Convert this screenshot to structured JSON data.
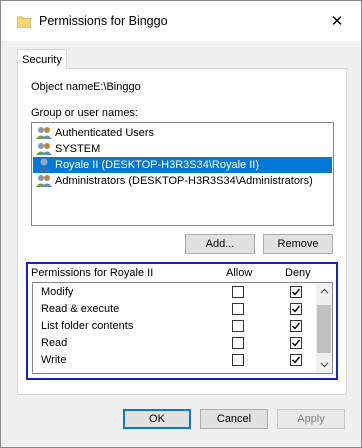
{
  "window": {
    "title": "Permissions for Binggo",
    "close_glyph": "✕"
  },
  "tabs": [
    {
      "label": "Security",
      "active": true
    }
  ],
  "object": {
    "label": "Object name:",
    "value": "E:\\Binggo"
  },
  "group": {
    "label": "Group or user names:",
    "items": [
      {
        "label": "Authenticated Users",
        "icon": "group-users-icon",
        "selected": false
      },
      {
        "label": "SYSTEM",
        "icon": "group-users-icon",
        "selected": false
      },
      {
        "label": "Royale II (DESKTOP-H3R3S34\\Royale II)",
        "icon": "user-icon",
        "selected": true
      },
      {
        "label": "Administrators (DESKTOP-H3R3S34\\Administrators)",
        "icon": "group-users-icon",
        "selected": false
      }
    ],
    "add_label": "Add...",
    "remove_label": "Remove"
  },
  "permissions": {
    "header": "Permissions for Royale II",
    "allow_header": "Allow",
    "deny_header": "Deny",
    "rows": [
      {
        "name": "Modify",
        "allow": false,
        "deny": true
      },
      {
        "name": "Read & execute",
        "allow": false,
        "deny": true
      },
      {
        "name": "List folder contents",
        "allow": false,
        "deny": true
      },
      {
        "name": "Read",
        "allow": false,
        "deny": true
      },
      {
        "name": "Write",
        "allow": false,
        "deny": true
      }
    ]
  },
  "footer": {
    "ok_label": "OK",
    "cancel_label": "Cancel",
    "apply_label": "Apply"
  },
  "colors": {
    "selection": "#0078d7",
    "highlight_border": "#1a21c9",
    "folder": "#f8d775"
  }
}
